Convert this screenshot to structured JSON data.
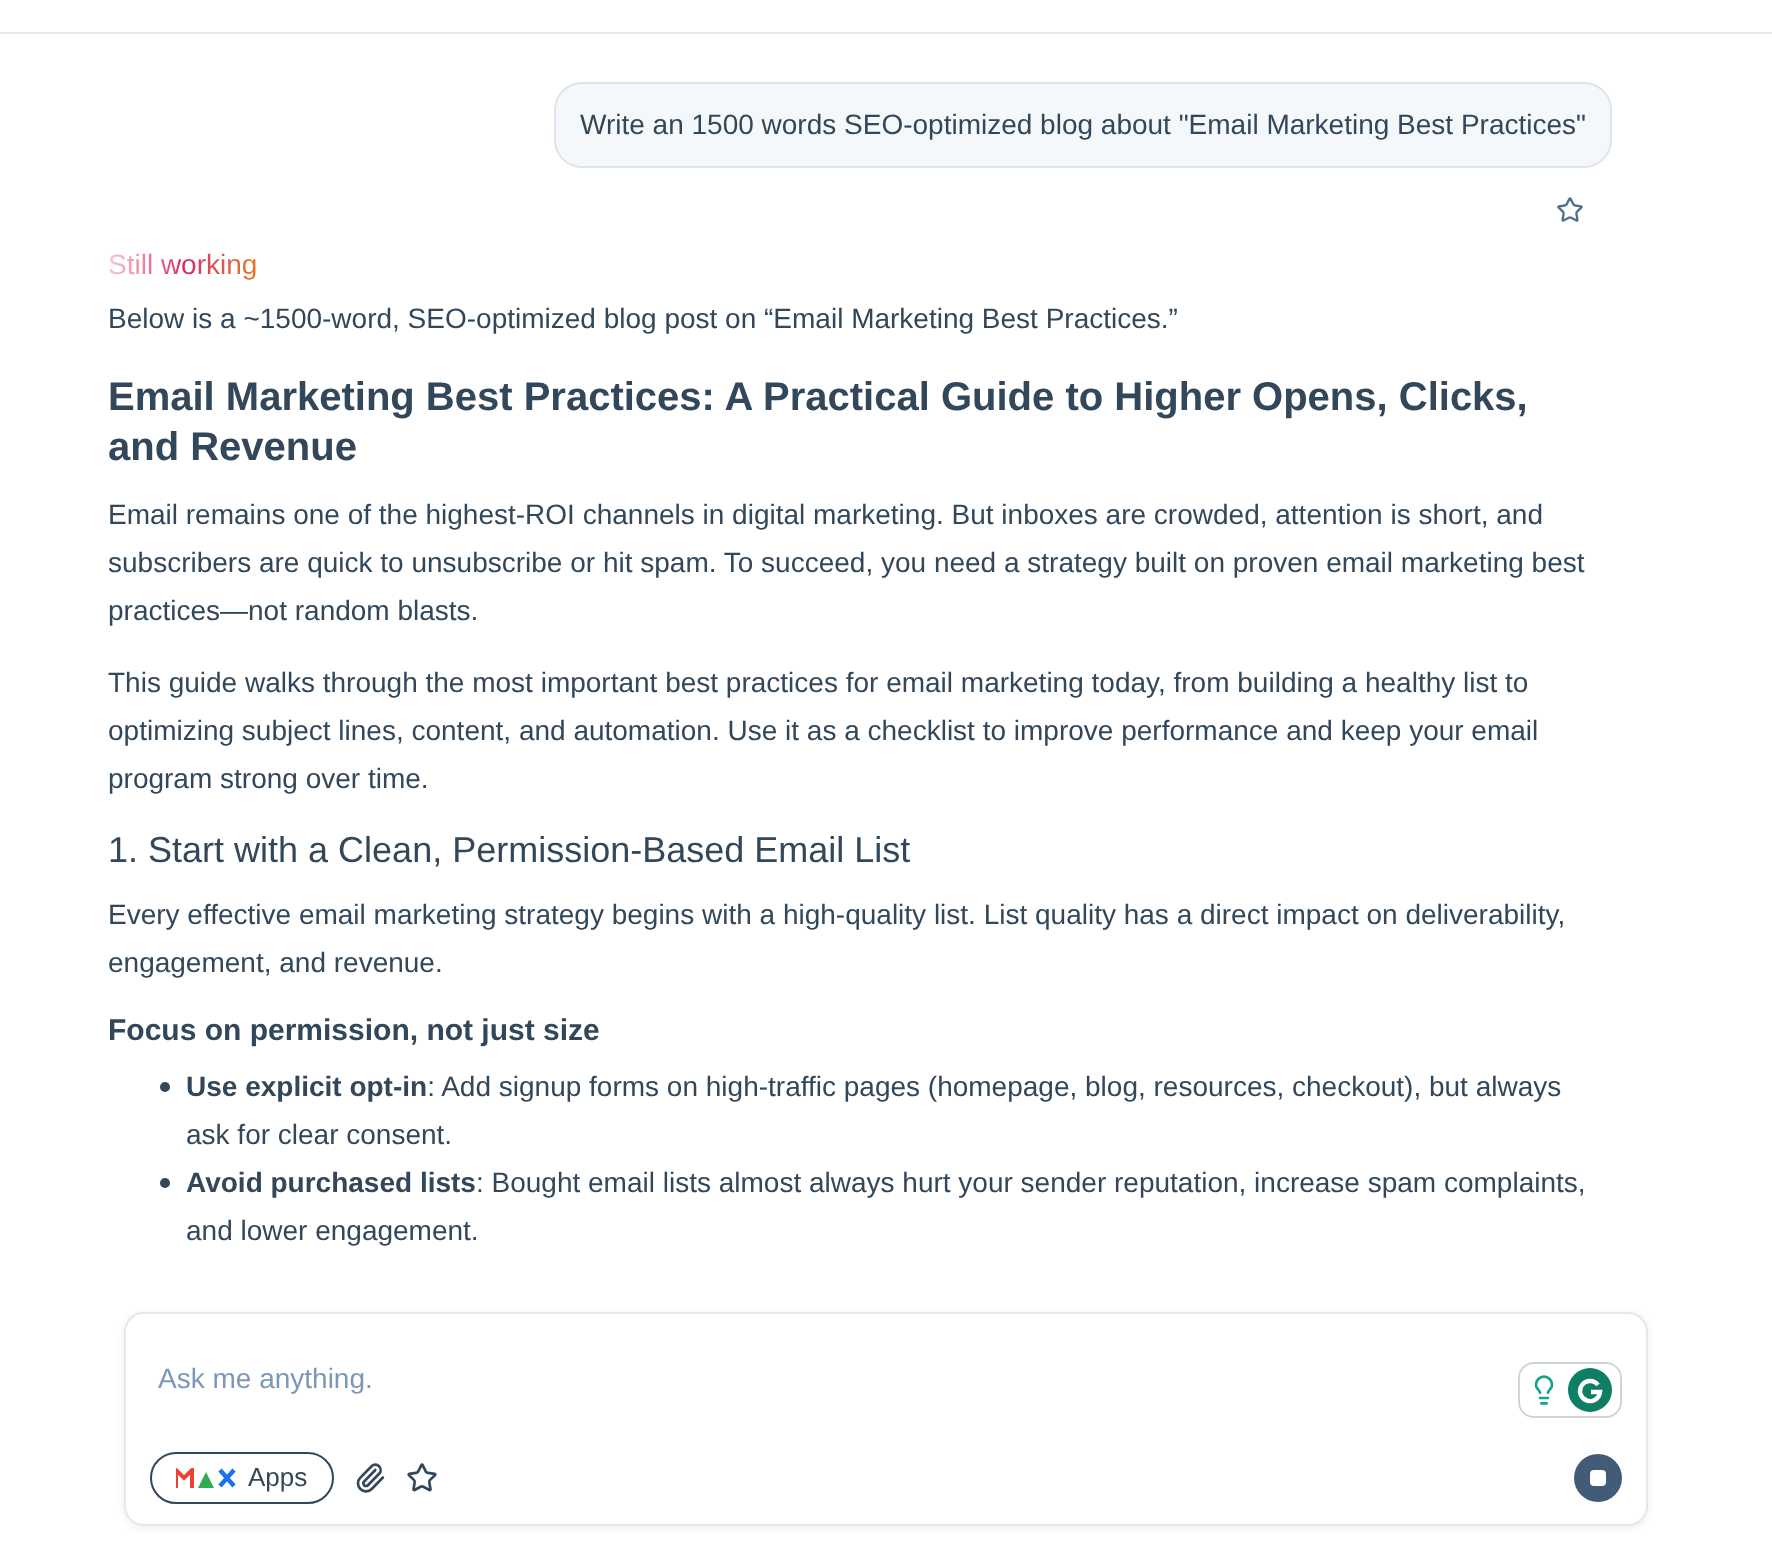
{
  "user_message": "Write an 1500 words SEO-optimized blog about \"Email Marketing Best Practices\"",
  "status": "Still working",
  "intro": "Below is a ~1500-word, SEO-optimized blog post on “Email Marketing Best Practices.”",
  "blocks": [
    {
      "kind": "h1",
      "text": "Email Marketing Best Practices: A Practical Guide to Higher Opens, Clicks, and Revenue"
    },
    {
      "kind": "p",
      "text": "Email remains one of the highest-ROI channels in digital marketing. But inboxes are crowded, attention is short, and subscribers are quick to unsubscribe or hit spam. To succeed, you need a strategy built on proven email marketing best practices—not random blasts."
    },
    {
      "kind": "p",
      "text": "This guide walks through the most important best practices for email marketing today, from building a healthy list to optimizing subject lines, content, and automation. Use it as a checklist to improve performance and keep your email program strong over time."
    },
    {
      "kind": "h2",
      "text": "1. Start with a Clean, Permission-Based Email List"
    },
    {
      "kind": "p",
      "text": "Every effective email marketing strategy begins with a high-quality list. List quality has a direct impact on deliverability, engagement, and revenue."
    },
    {
      "kind": "h3",
      "text": "Focus on permission, not just size"
    },
    {
      "kind": "li",
      "text": "**Use explicit opt-in**: Add signup forms on high-traffic pages (homepage, blog, resources, checkout), but always ask for clear consent."
    },
    {
      "kind": "li",
      "text": "**Avoid purchased lists**: Bought email lists almost always hurt your sender reputation, increase spam complaints, and lower engagement."
    }
  ],
  "composer": {
    "placeholder": "Ask me anything.",
    "apps_label": "Apps",
    "generating": true
  }
}
